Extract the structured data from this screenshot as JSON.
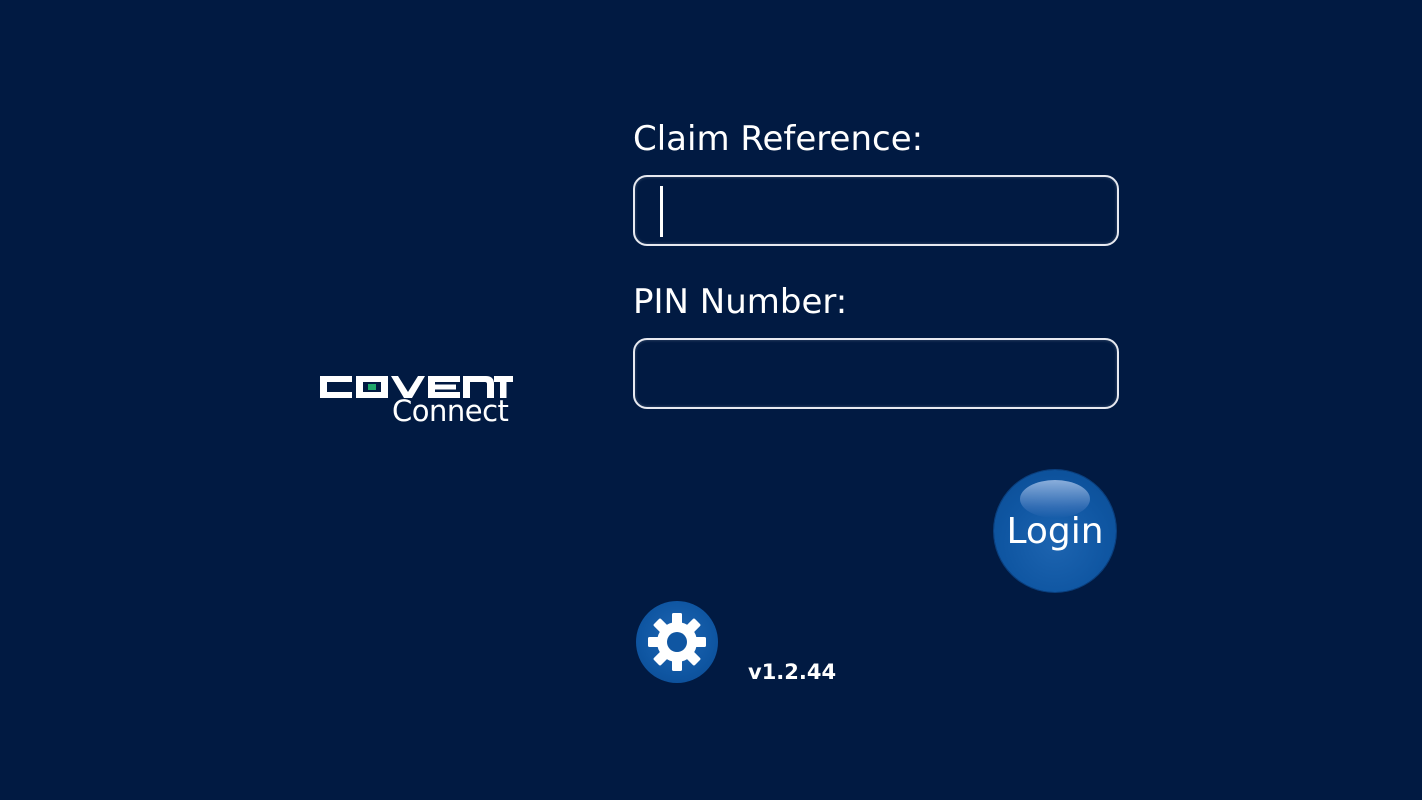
{
  "app": {
    "background_color": "#011a42",
    "accent_color": "#0f56a2"
  },
  "logo": {
    "main_text": "COVENT",
    "sub_text": "Connect",
    "accent_square_color": "#1fa76a"
  },
  "form": {
    "claim_reference": {
      "label": "Claim Reference:",
      "value": "",
      "placeholder": ""
    },
    "pin_number": {
      "label": "PIN Number:",
      "value": "",
      "placeholder": ""
    }
  },
  "login_button": {
    "label": "Login"
  },
  "settings": {
    "icon": "gear-icon"
  },
  "footer": {
    "version": "v1.2.44"
  }
}
